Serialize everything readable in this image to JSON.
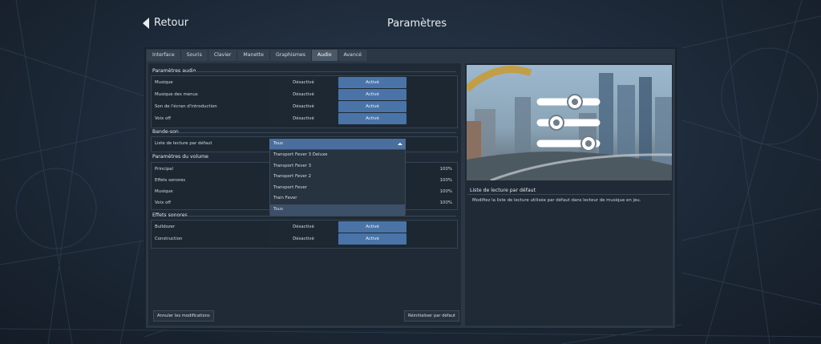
{
  "header": {
    "back_label": "Retour",
    "title": "Paramètres"
  },
  "tabs": [
    "Interface",
    "Souris",
    "Clavier",
    "Manette",
    "Graphismes",
    "Audio",
    "Avancé"
  ],
  "active_tab": "Audio",
  "sections": {
    "audio": "Paramètres audio",
    "soundtrack": "Bande-son",
    "volume": "Paramètres du volume",
    "effects": "Effets sonores"
  },
  "toggle_labels": {
    "off": "Désactivé",
    "on": "Activé"
  },
  "audio_rows": [
    "Musique",
    "Musique des menus",
    "Son de l'écran d'introduction",
    "Voix off"
  ],
  "playlist": {
    "label": "Liste de lecture par défaut",
    "value": "Tous",
    "options": [
      "Transport Fever 3 Deluxe",
      "Transport Fever 3",
      "Transport Fever 2",
      "Transport Fever",
      "Train Fever",
      "Tous"
    ]
  },
  "volume_rows": [
    {
      "label": "Principal",
      "value": "100%"
    },
    {
      "label": "Effets sonores",
      "value": "100%"
    },
    {
      "label": "Musique",
      "value": "100%"
    },
    {
      "label": "Voix off",
      "value": "100%"
    }
  ],
  "effect_rows": [
    "Bulldozer",
    "Construction"
  ],
  "footer": {
    "cancel": "Annuler les modifications",
    "reset": "Réinitialiser par défaut"
  },
  "info": {
    "title": "Liste de lecture par défaut",
    "text": "Modifiez la liste de lecture utilisée par défaut dans lecteur de musique en jeu."
  },
  "colors": {
    "accent": "#4a74a8",
    "panel": "#2b3744",
    "background": "#1d2938"
  }
}
